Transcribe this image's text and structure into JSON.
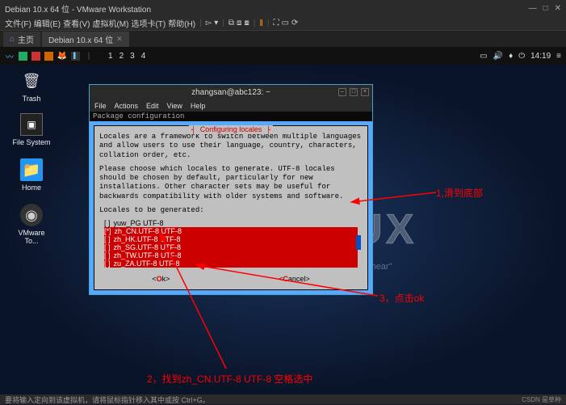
{
  "vmware": {
    "title": "Debian 10.x 64 位 - VMware Workstation",
    "menu": [
      "文件(F)",
      "编辑(E)",
      "查看(V)",
      "虚拟机(M)",
      "选项卡(T)",
      "帮助(H)"
    ],
    "tabs": {
      "home": "主页",
      "active": "Debian 10.x 64 位"
    }
  },
  "guest_top": {
    "workspaces": [
      "1",
      "2",
      "3",
      "4"
    ],
    "time": "14:19"
  },
  "desktop_icons": {
    "trash": "Trash",
    "fs": "File System",
    "home": "Home",
    "vmtools": "VMware To..."
  },
  "bg": {
    "kali": "KALI LINUX",
    "sub": "\"the quieter you become the more you are able to hear\""
  },
  "terminal": {
    "title": "zhangsan@abc123: ~",
    "menu": [
      "File",
      "Actions",
      "Edit",
      "View",
      "Help"
    ],
    "pkg_label": "Package configuration"
  },
  "dialog": {
    "title": "Configuring locales",
    "para1": "Locales are a framework to switch between multiple languages and allow users to use their language, country, characters, collation order, etc.",
    "para2": "Please choose which locales to generate. UTF-8 locales should be chosen by default, particularly for new installations. Other character sets may be useful for backwards compatibility with older systems and software.",
    "para3": "Locales to be generated:",
    "locales": [
      {
        "checked": false,
        "label": "yuw_PG UTF-8",
        "sel": false
      },
      {
        "checked": true,
        "label": "zh_CN.UTF-8 UTF-8",
        "sel": true
      },
      {
        "checked": false,
        "label": "zh_HK.UTF-8 UTF-8",
        "sel": true
      },
      {
        "checked": false,
        "label": "zh_SG.UTF-8 UTF-8",
        "sel": true
      },
      {
        "checked": false,
        "label": "zh_TW.UTF-8 UTF-8",
        "sel": true
      },
      {
        "checked": false,
        "label": "zu_ZA.UTF-8 UTF-8",
        "sel": true
      }
    ],
    "ok": "<Ok>",
    "cancel": "<Cancel>"
  },
  "annotations": {
    "a1": "1,滑到底部",
    "a2": "2，找到zh_CN.UTF-8 UTF-8 空格选中",
    "a3": "3，点击ok"
  },
  "status": "要将输入定向到该虚拟机，请将鼠标指针移入其中或按 Ctrl+G。",
  "watermark": "CSDN 是草种"
}
